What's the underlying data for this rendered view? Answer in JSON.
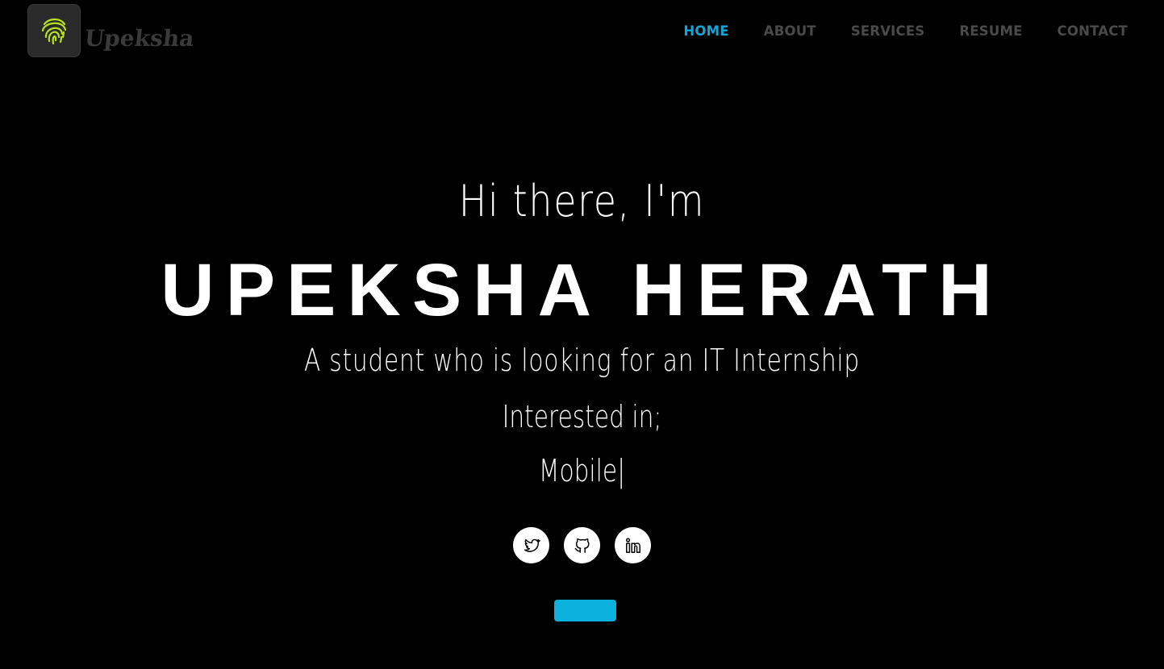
{
  "brand": {
    "logo_text": "Upeksha",
    "logo_icon": "fingerprint-icon",
    "accent_color": "#b7e21b"
  },
  "nav": {
    "items": [
      {
        "label": "HOME",
        "active": true
      },
      {
        "label": "ABOUT",
        "active": false
      },
      {
        "label": "SERVICES",
        "active": false
      },
      {
        "label": "RESUME",
        "active": false
      },
      {
        "label": "CONTACT",
        "active": false
      }
    ],
    "active_color": "#10a7d8"
  },
  "hero": {
    "greeting": "Hi there, I'm",
    "name": "UPEKSHA HERATH",
    "tagline": "A student who is looking for an IT Internship",
    "interest_label": "Interested in;",
    "typed_text": "Mobile|"
  },
  "socials": [
    {
      "icon": "twitter-icon"
    },
    {
      "icon": "github-icon"
    },
    {
      "icon": "linkedin-icon"
    }
  ],
  "cta": {
    "label": "",
    "color": "#0cb0dc"
  }
}
